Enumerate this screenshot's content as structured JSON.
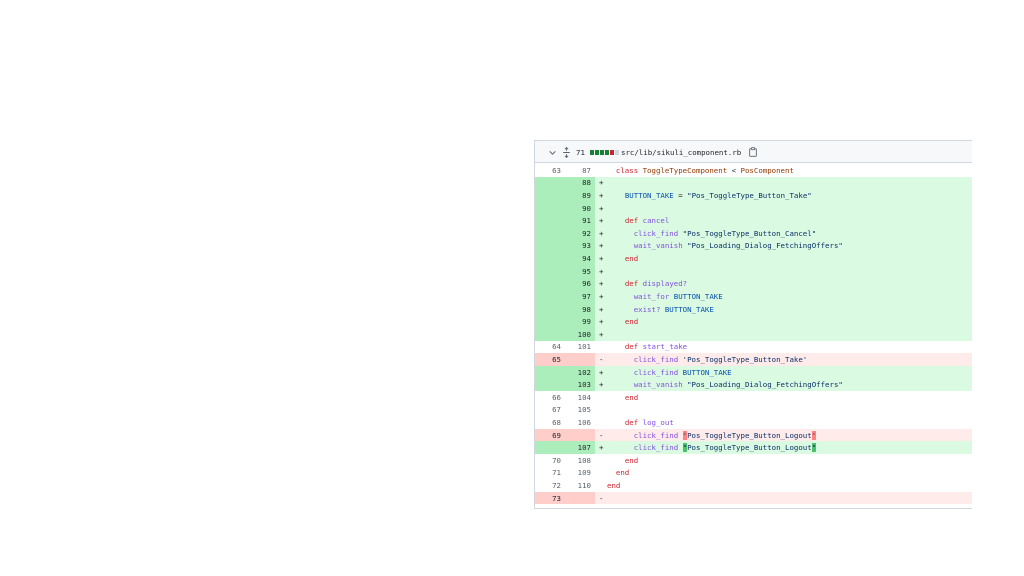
{
  "file": {
    "line_count": "71",
    "name": "src/lib/sikuli_component.rb",
    "diffstat_colors": [
      "#1a7f37",
      "#1a7f37",
      "#1a7f37",
      "#1a7f37",
      "#cf222e",
      "#d0d7de"
    ]
  },
  "icons": {
    "collapse": "chevron-down-icon",
    "expand": "unfold-icon",
    "copy": "clipboard-icon"
  },
  "lines": [
    {
      "type": "ctx",
      "old": "63",
      "new": "87",
      "mark": "",
      "tokens": [
        [
          "",
          "  "
        ],
        [
          "kw",
          "class"
        ],
        [
          "",
          " "
        ],
        [
          "cls",
          "ToggleTypeComponent"
        ],
        [
          "",
          " < "
        ],
        [
          "cls",
          "PosComponent"
        ]
      ]
    },
    {
      "type": "add",
      "old": "",
      "new": "88",
      "mark": "+",
      "tokens": []
    },
    {
      "type": "add",
      "old": "",
      "new": "89",
      "mark": "+",
      "tokens": [
        [
          "",
          "    "
        ],
        [
          "const",
          "BUTTON_TAKE"
        ],
        [
          "",
          " = "
        ],
        [
          "str",
          "\"Pos_ToggleType_Button_Take\""
        ]
      ]
    },
    {
      "type": "add",
      "old": "",
      "new": "90",
      "mark": "+",
      "tokens": []
    },
    {
      "type": "add",
      "old": "",
      "new": "91",
      "mark": "+",
      "tokens": [
        [
          "",
          "    "
        ],
        [
          "kw",
          "def"
        ],
        [
          "",
          " "
        ],
        [
          "fn",
          "cancel"
        ]
      ]
    },
    {
      "type": "add",
      "old": "",
      "new": "92",
      "mark": "+",
      "tokens": [
        [
          "",
          "      "
        ],
        [
          "fn",
          "click_find"
        ],
        [
          "",
          " "
        ],
        [
          "str",
          "\"Pos_ToggleType_Button_Cancel\""
        ]
      ]
    },
    {
      "type": "add",
      "old": "",
      "new": "93",
      "mark": "+",
      "tokens": [
        [
          "",
          "      "
        ],
        [
          "fn",
          "wait_vanish"
        ],
        [
          "",
          " "
        ],
        [
          "str",
          "\"Pos_Loading_Dialog_FetchingOffers\""
        ]
      ]
    },
    {
      "type": "add",
      "old": "",
      "new": "94",
      "mark": "+",
      "tokens": [
        [
          "",
          "    "
        ],
        [
          "kw",
          "end"
        ]
      ]
    },
    {
      "type": "add",
      "old": "",
      "new": "95",
      "mark": "+",
      "tokens": []
    },
    {
      "type": "add",
      "old": "",
      "new": "96",
      "mark": "+",
      "tokens": [
        [
          "",
          "    "
        ],
        [
          "kw",
          "def"
        ],
        [
          "",
          " "
        ],
        [
          "fn",
          "displayed?"
        ]
      ]
    },
    {
      "type": "add",
      "old": "",
      "new": "97",
      "mark": "+",
      "tokens": [
        [
          "",
          "      "
        ],
        [
          "fn",
          "wait_for"
        ],
        [
          "",
          " "
        ],
        [
          "const",
          "BUTTON_TAKE"
        ]
      ]
    },
    {
      "type": "add",
      "old": "",
      "new": "98",
      "mark": "+",
      "tokens": [
        [
          "",
          "      "
        ],
        [
          "fn",
          "exist?"
        ],
        [
          "",
          " "
        ],
        [
          "const",
          "BUTTON_TAKE"
        ]
      ]
    },
    {
      "type": "add",
      "old": "",
      "new": "99",
      "mark": "+",
      "tokens": [
        [
          "",
          "    "
        ],
        [
          "kw",
          "end"
        ]
      ]
    },
    {
      "type": "add",
      "old": "",
      "new": "100",
      "mark": "+",
      "tokens": []
    },
    {
      "type": "ctx",
      "old": "64",
      "new": "101",
      "mark": "",
      "tokens": [
        [
          "",
          "    "
        ],
        [
          "kw",
          "def"
        ],
        [
          "",
          " "
        ],
        [
          "fn",
          "start_take"
        ]
      ]
    },
    {
      "type": "del",
      "old": "65",
      "new": "",
      "mark": "-",
      "tokens": [
        [
          "",
          "      "
        ],
        [
          "fn",
          "click_find"
        ],
        [
          "",
          " "
        ],
        [
          "str",
          "'Pos_ToggleType_Button_Take'"
        ]
      ]
    },
    {
      "type": "add",
      "old": "",
      "new": "102",
      "mark": "+",
      "tokens": [
        [
          "",
          "      "
        ],
        [
          "fn",
          "click_find"
        ],
        [
          "",
          " "
        ],
        [
          "const",
          "BUTTON_TAKE"
        ]
      ]
    },
    {
      "type": "add",
      "old": "",
      "new": "103",
      "mark": "+",
      "tokens": [
        [
          "",
          "      "
        ],
        [
          "fn",
          "wait_vanish"
        ],
        [
          "",
          " "
        ],
        [
          "str",
          "\"Pos_Loading_Dialog_FetchingOffers\""
        ]
      ]
    },
    {
      "type": "ctx",
      "old": "66",
      "new": "104",
      "mark": "",
      "tokens": [
        [
          "",
          "    "
        ],
        [
          "kw",
          "end"
        ]
      ]
    },
    {
      "type": "ctx",
      "old": "67",
      "new": "105",
      "mark": "",
      "tokens": []
    },
    {
      "type": "ctx",
      "old": "68",
      "new": "106",
      "mark": "",
      "tokens": [
        [
          "",
          "    "
        ],
        [
          "kw",
          "def"
        ],
        [
          "",
          " "
        ],
        [
          "fn",
          "log_out"
        ]
      ]
    },
    {
      "type": "del",
      "old": "69",
      "new": "",
      "mark": "-",
      "tokens": [
        [
          "",
          "      "
        ],
        [
          "fn",
          "click_find"
        ],
        [
          "",
          " "
        ],
        [
          "str hl-del",
          "'"
        ],
        [
          "str",
          "Pos_ToggleType_Button_Logout"
        ],
        [
          "str hl-del",
          "'"
        ]
      ]
    },
    {
      "type": "add",
      "old": "",
      "new": "107",
      "mark": "+",
      "tokens": [
        [
          "",
          "      "
        ],
        [
          "fn",
          "click_find"
        ],
        [
          "",
          " "
        ],
        [
          "str hl-add",
          "\""
        ],
        [
          "str",
          "Pos_ToggleType_Button_Logout"
        ],
        [
          "str hl-add",
          "\""
        ]
      ]
    },
    {
      "type": "ctx",
      "old": "70",
      "new": "108",
      "mark": "",
      "tokens": [
        [
          "",
          "    "
        ],
        [
          "kw",
          "end"
        ]
      ]
    },
    {
      "type": "ctx",
      "old": "71",
      "new": "109",
      "mark": "",
      "tokens": [
        [
          "",
          "  "
        ],
        [
          "kw",
          "end"
        ]
      ]
    },
    {
      "type": "ctx",
      "old": "72",
      "new": "110",
      "mark": "",
      "tokens": [
        [
          "kw",
          "end"
        ]
      ]
    },
    {
      "type": "del",
      "old": "73",
      "new": "",
      "mark": "-",
      "tokens": []
    }
  ]
}
